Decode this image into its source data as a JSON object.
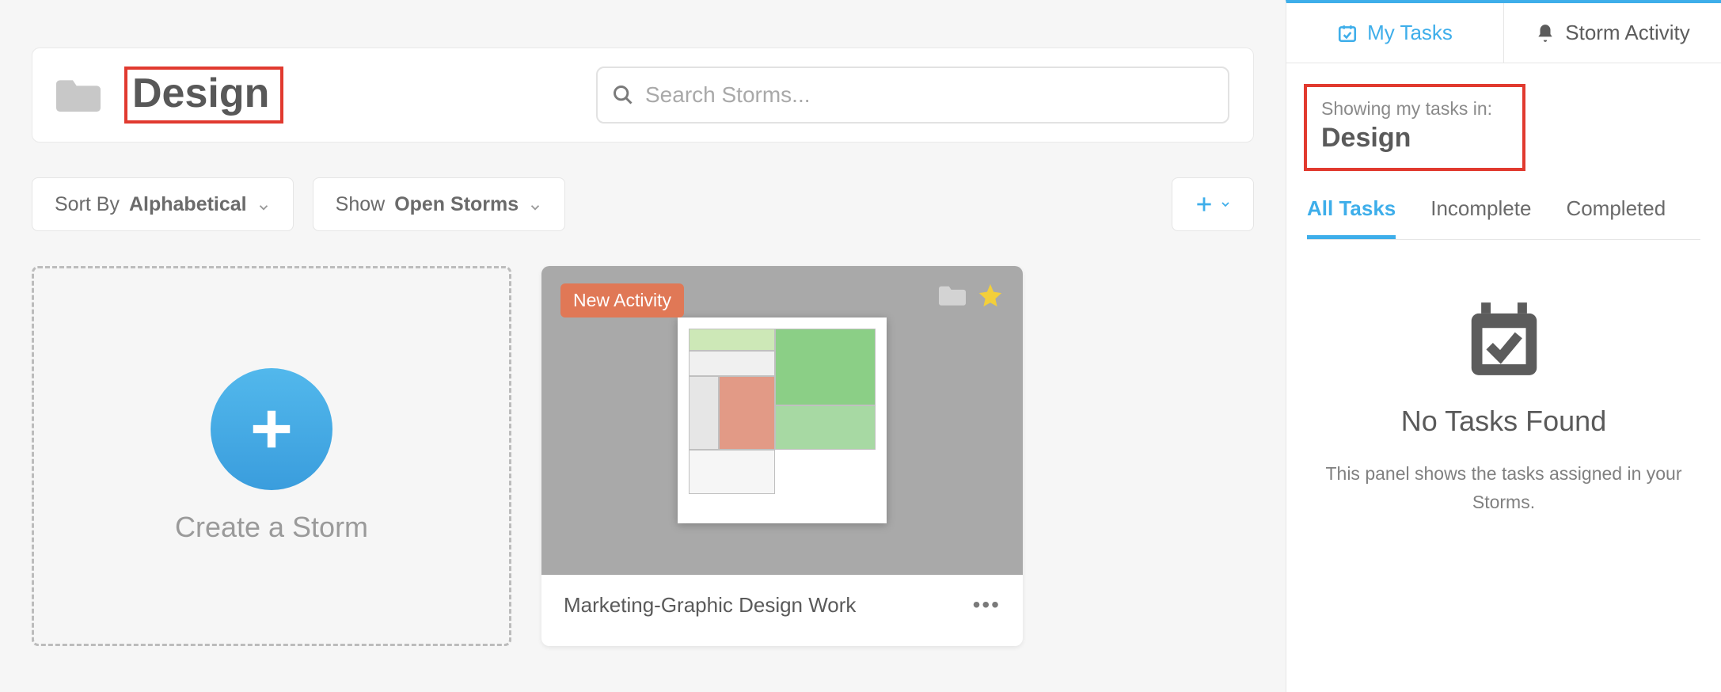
{
  "header": {
    "folder_title": "Design",
    "search_placeholder": "Search Storms..."
  },
  "toolbar": {
    "sort_label_prefix": "Sort By ",
    "sort_label_value": "Alphabetical",
    "show_label_prefix": "Show ",
    "show_label_value": "Open Storms"
  },
  "create_card": {
    "label": "Create a Storm"
  },
  "storm": {
    "badge": "New Activity",
    "title": "Marketing-Graphic Design Work",
    "colors": {
      "green": "#8bcf86",
      "light_green": "#cde8b7",
      "red": "#e29a86",
      "gray": "#e6e6e6"
    }
  },
  "sidebar": {
    "tab_my_tasks": "My Tasks",
    "tab_activity": "Storm Activity",
    "context_label": "Showing my tasks in:",
    "context_value": "Design",
    "task_tabs": {
      "all": "All Tasks",
      "incomplete": "Incomplete",
      "completed": "Completed"
    },
    "empty_title": "No Tasks Found",
    "empty_sub": "This panel shows the tasks assigned in your Storms."
  }
}
